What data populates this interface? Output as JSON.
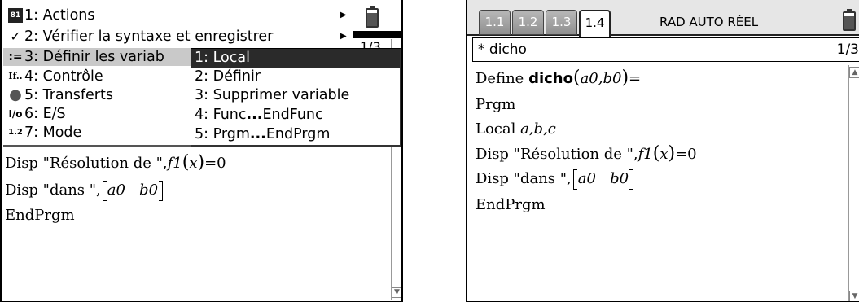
{
  "left_screen": {
    "menu": {
      "items": [
        {
          "icon": "calculator-icon",
          "icon_glyph": "81",
          "label": "1: Actions",
          "has_submenu": true
        },
        {
          "icon": "checkmark-icon",
          "icon_glyph": "✓",
          "label": "2: Vérifier la syntaxe et enregistrer",
          "has_submenu": true
        },
        {
          "icon": "assign-icon",
          "icon_glyph": ":=",
          "label": "3: Définir les variab",
          "has_submenu": true,
          "highlighted": true
        },
        {
          "icon": "if-icon",
          "icon_glyph": "If..",
          "label": "4: Contrôle",
          "has_submenu": true
        },
        {
          "icon": "stop-icon",
          "icon_glyph": "●",
          "label": "5: Transferts",
          "has_submenu": true
        },
        {
          "icon": "io-icon",
          "icon_glyph": "I/o",
          "label": "6: E/S",
          "has_submenu": true
        },
        {
          "icon": "mode-icon",
          "icon_glyph": "1.2",
          "label": "7: Mode",
          "has_submenu": true
        }
      ]
    },
    "submenu": {
      "items": [
        {
          "label": "1: Local",
          "selected": true
        },
        {
          "label": "2: Définir"
        },
        {
          "label": "3: Supprimer variable"
        },
        {
          "label": "4: Func...EndFunc"
        },
        {
          "label": "5: Prgm...EndPrgm"
        }
      ]
    },
    "background_page_fragment": "1/3",
    "code": {
      "line1_prefix": "Disp \"Résolution de \",",
      "line1_func": "f1",
      "line1_arg": "x",
      "line1_suffix": "=0",
      "line2_prefix": "Disp \"dans \",",
      "line2_a": "a0",
      "line2_b": "b0",
      "line3": "EndPrgm"
    }
  },
  "right_screen": {
    "tabs": [
      {
        "label": "1.1",
        "active": false
      },
      {
        "label": "1.2",
        "active": false
      },
      {
        "label": "1.3",
        "active": false
      },
      {
        "label": "1.4",
        "active": true
      }
    ],
    "mode_status": "RAD AUTO RÉEL",
    "file_title": "* dicho",
    "page_indicator": "1/3",
    "code": {
      "define_prefix": "Define ",
      "define_name": "dicho",
      "define_args": "a0,b0",
      "define_suffix": "=",
      "prgm": "Prgm",
      "local_kw": "Local ",
      "local_vars": "a,b,c",
      "disp1_prefix": "Disp \"Résolution de \",",
      "disp1_func": "f1",
      "disp1_arg": "x",
      "disp1_suffix": "=0",
      "disp2_prefix": "Disp \"dans \",",
      "disp2_a": "a0",
      "disp2_b": "b0",
      "endprgm": "EndPrgm"
    }
  },
  "colors": {
    "menu_highlight": "#c9c9c9",
    "submenu_selected_bg": "#2a2a2a",
    "tab_inactive": "#a0a0a0",
    "tab_bar_bg": "#e6e6e6"
  }
}
